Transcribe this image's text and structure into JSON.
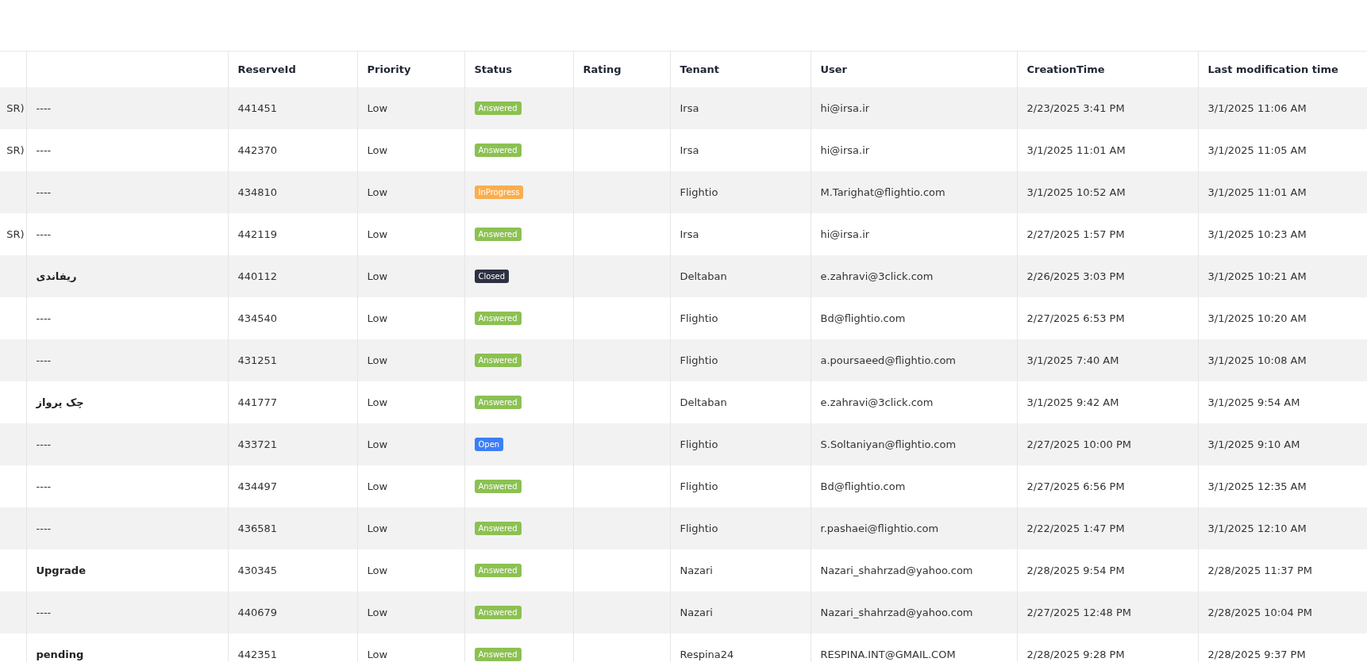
{
  "table": {
    "columns": [
      "",
      "",
      "ReserveId",
      "Priority",
      "Status",
      "Rating",
      "Tenant",
      "User",
      "CreationTime",
      "Last modification time"
    ],
    "rows": [
      {
        "column_1": "SR)",
        "column_2": "----",
        "bold": false,
        "reserve_id": "441451",
        "priority": "Low",
        "status": {
          "label": "Answered",
          "color": "#8cc152"
        },
        "tenant": "Irsa",
        "user": "hi@irsa.ir",
        "creation_time": "2/23/2025 3:41 PM",
        "last_modification_time": "3/1/2025 11:06 AM"
      },
      {
        "column_1": "SR)",
        "column_2": "----",
        "bold": false,
        "reserve_id": "442370",
        "priority": "Low",
        "status": {
          "label": "Answered",
          "color": "#8cc152"
        },
        "tenant": "Irsa",
        "user": "hi@irsa.ir",
        "creation_time": "3/1/2025 11:01 AM",
        "last_modification_time": "3/1/2025 11:05 AM"
      },
      {
        "column_1": "",
        "column_2": "----",
        "bold": false,
        "reserve_id": "434810",
        "priority": "Low",
        "status": {
          "label": "InProgress",
          "color": "#fbae4c"
        },
        "tenant": "Flightio",
        "user": "M.Tarighat@flightio.com",
        "creation_time": "3/1/2025 10:52 AM",
        "last_modification_time": "3/1/2025 11:01 AM"
      },
      {
        "column_1": "SR)",
        "column_2": "----",
        "bold": false,
        "reserve_id": "442119",
        "priority": "Low",
        "status": {
          "label": "Answered",
          "color": "#8cc152"
        },
        "tenant": "Irsa",
        "user": "hi@irsa.ir",
        "creation_time": "2/27/2025 1:57 PM",
        "last_modification_time": "3/1/2025 10:23 AM"
      },
      {
        "column_1": "",
        "column_2": "ریفاندی",
        "bold": true,
        "reserve_id": "440112",
        "priority": "Low",
        "status": {
          "label": "Closed",
          "color": "#2d3142"
        },
        "tenant": "Deltaban",
        "user": "e.zahravi@3click.com",
        "creation_time": "2/26/2025 3:03 PM",
        "last_modification_time": "3/1/2025 10:21 AM"
      },
      {
        "column_1": "",
        "column_2": "----",
        "bold": false,
        "reserve_id": "434540",
        "priority": "Low",
        "status": {
          "label": "Answered",
          "color": "#8cc152"
        },
        "tenant": "Flightio",
        "user": "Bd@flightio.com",
        "creation_time": "2/27/2025 6:53 PM",
        "last_modification_time": "3/1/2025 10:20 AM"
      },
      {
        "column_1": "",
        "column_2": "----",
        "bold": false,
        "reserve_id": "431251",
        "priority": "Low",
        "status": {
          "label": "Answered",
          "color": "#8cc152"
        },
        "tenant": "Flightio",
        "user": "a.poursaeed@flightio.com",
        "creation_time": "3/1/2025 7:40 AM",
        "last_modification_time": "3/1/2025 10:08 AM"
      },
      {
        "column_1": "",
        "column_2": "چک پرواز",
        "bold": true,
        "reserve_id": "441777",
        "priority": "Low",
        "status": {
          "label": "Answered",
          "color": "#8cc152"
        },
        "tenant": "Deltaban",
        "user": "e.zahravi@3click.com",
        "creation_time": "3/1/2025 9:42 AM",
        "last_modification_time": "3/1/2025 9:54 AM"
      },
      {
        "column_1": "",
        "column_2": "----",
        "bold": false,
        "reserve_id": "433721",
        "priority": "Low",
        "status": {
          "label": "Open",
          "color": "#3d7ef5"
        },
        "tenant": "Flightio",
        "user": "S.Soltaniyan@flightio.com",
        "creation_time": "2/27/2025 10:00 PM",
        "last_modification_time": "3/1/2025 9:10 AM"
      },
      {
        "column_1": "",
        "column_2": "----",
        "bold": false,
        "reserve_id": "434497",
        "priority": "Low",
        "status": {
          "label": "Answered",
          "color": "#8cc152"
        },
        "tenant": "Flightio",
        "user": "Bd@flightio.com",
        "creation_time": "2/27/2025 6:56 PM",
        "last_modification_time": "3/1/2025 12:35 AM"
      },
      {
        "column_1": "",
        "column_2": "----",
        "bold": false,
        "reserve_id": "436581",
        "priority": "Low",
        "status": {
          "label": "Answered",
          "color": "#8cc152"
        },
        "tenant": "Flightio",
        "user": "r.pashaei@flightio.com",
        "creation_time": "2/22/2025 1:47 PM",
        "last_modification_time": "3/1/2025 12:10 AM"
      },
      {
        "column_1": "",
        "column_2": "Upgrade",
        "bold": true,
        "reserve_id": "430345",
        "priority": "Low",
        "status": {
          "label": "Answered",
          "color": "#8cc152"
        },
        "tenant": "Nazari",
        "user": "Nazari_shahrzad@yahoo.com",
        "creation_time": "2/28/2025 9:54 PM",
        "last_modification_time": "2/28/2025 11:37 PM"
      },
      {
        "column_1": "",
        "column_2": "----",
        "bold": false,
        "reserve_id": "440679",
        "priority": "Low",
        "status": {
          "label": "Answered",
          "color": "#8cc152"
        },
        "tenant": "Nazari",
        "user": "Nazari_shahrzad@yahoo.com",
        "creation_time": "2/27/2025 12:48 PM",
        "last_modification_time": "2/28/2025 10:04 PM"
      },
      {
        "column_1": "",
        "column_2": "pending",
        "bold": true,
        "reserve_id": "442351",
        "priority": "Low",
        "status": {
          "label": "Answered",
          "color": "#8cc152"
        },
        "tenant": "Respina24",
        "user": "RESPINA.INT@GMAIL.COM",
        "creation_time": "2/28/2025 9:28 PM",
        "last_modification_time": "2/28/2025 9:37 PM"
      }
    ]
  }
}
